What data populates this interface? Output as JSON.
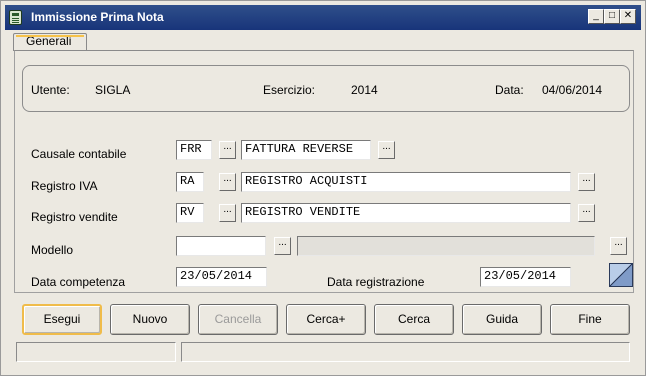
{
  "window": {
    "title": "Immissione Prima Nota",
    "icon": "ledger-icon",
    "controls": {
      "minimize": "_",
      "maximize": "□",
      "close": "✕"
    }
  },
  "tabs": [
    {
      "label": "Generali",
      "active": true
    }
  ],
  "info": {
    "user_label": "Utente:",
    "user_value": "SIGLA",
    "year_label": "Esercizio:",
    "year_value": "2014",
    "date_label": "Data:",
    "date_value": "04/06/2014"
  },
  "form": {
    "causale": {
      "label": "Causale contabile",
      "code": "FRR",
      "description": "FATTURA REVERSE"
    },
    "registro_iva": {
      "label": "Registro IVA",
      "code": "RA",
      "description": "REGISTRO ACQUISTI"
    },
    "registro_vendite": {
      "label": "Registro vendite",
      "code": "RV",
      "description": "REGISTRO VENDITE"
    },
    "modello": {
      "label": "Modello",
      "code": "",
      "description": ""
    },
    "data_competenza": {
      "label": "Data competenza",
      "value": "23/05/2014"
    },
    "data_registrazione": {
      "label": "Data registrazione",
      "value": "23/05/2014"
    },
    "lookup_glyph": "..."
  },
  "buttons": {
    "esegui": "Esegui",
    "nuovo": "Nuovo",
    "cancella": "Cancella",
    "cerca_plus": "Cerca+",
    "cerca": "Cerca",
    "guida": "Guida",
    "fine": "Fine"
  },
  "colors": {
    "titlebar": "#18347a",
    "default_button_border": "#f0bc4a",
    "window_bg": "#ece9e1"
  }
}
